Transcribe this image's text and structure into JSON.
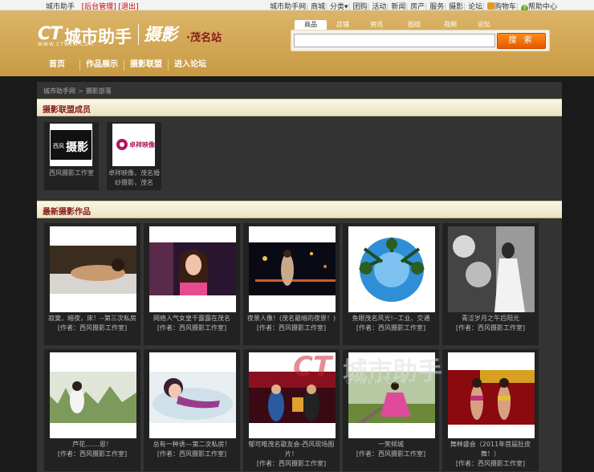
{
  "topbar": {
    "site_name": "城市助手",
    "admin_link": "后台管理",
    "logout_link": "退出",
    "links": [
      "城市助手网",
      "商城",
      "分类",
      "团购",
      "活动",
      "新闻",
      "房产",
      "服务",
      "摄影",
      "论坛"
    ],
    "cart": "购物车",
    "help": "帮助中心"
  },
  "header": {
    "logo_mark": "CT",
    "logo_text": "城市助手",
    "logo_url": "WWW.CTWEN.COM",
    "photo_title": "摄影",
    "city_title": "·茂名站"
  },
  "search": {
    "tabs": [
      "商品",
      "店铺",
      "资讯",
      "图组",
      "视频",
      "论坛"
    ],
    "active_tab": "商品",
    "button": "搜 索",
    "placeholder": ""
  },
  "nav": {
    "items": [
      "首页",
      "作品展示",
      "摄影联盟",
      "进入论坛"
    ]
  },
  "breadcrumb": {
    "home": "城市助手网",
    "current": "摄影部落"
  },
  "members_section": {
    "title": "摄影联盟成员",
    "members": [
      {
        "name": "西风摄影工作室",
        "logo_text": "西风 摄影"
      },
      {
        "name": "卓祥映像，茂名婚纱摄影，茂名",
        "logo_text": "卓祥映像"
      }
    ]
  },
  "works_section": {
    "title": "最新摄影作品",
    "works": [
      {
        "title": "寂寞，暗夜，床！--第三次私房",
        "author": "[作者：西风摄影工作室]"
      },
      {
        "title": "网络人气女皇千露露在茂名",
        "author": "[作者：西风摄影工作室]"
      },
      {
        "title": "夜景人像！(茂名最暗的夜景！)",
        "author": "[作者：西风摄影工作室]"
      },
      {
        "title": "鱼眼茂名风光!--工业、交通",
        "author": "[作者：西风摄影工作室]"
      },
      {
        "title": "青涩岁月之午后阳光",
        "author": "[作者：西风摄影工作室]"
      },
      {
        "title": "芦花.......恩！",
        "author": "[作者：西风摄影工作室]"
      },
      {
        "title": "总有一种诱---第二次私房！",
        "author": "[作者：西风摄影工作室]"
      },
      {
        "title": "郁可唯茂名歌友会-西风现场图片！",
        "author": "[作者：西风摄影工作室]"
      },
      {
        "title": "一笑倾城",
        "author": "[作者：西风摄影工作室]"
      },
      {
        "title": "舞林盛会（2011年首届肚皮舞！）",
        "author": "[作者：西风摄影工作室]"
      }
    ]
  },
  "watermark": {
    "logo": "CT",
    "text": "城市助手",
    "url": "CTWEN.COM"
  }
}
